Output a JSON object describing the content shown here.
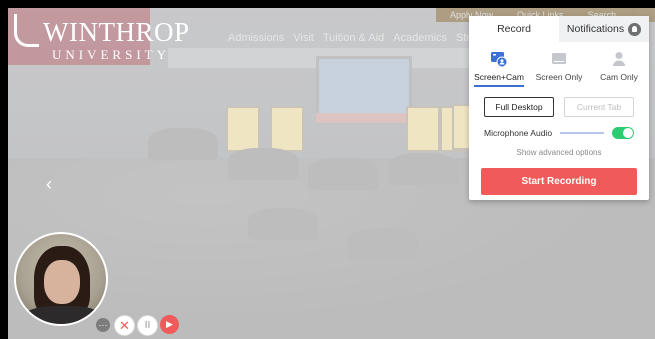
{
  "website": {
    "logo_main": "WINTHROP",
    "logo_sub": "UNIVERSITY",
    "nav": [
      "Admissions",
      "Visit",
      "Tuition & Aid",
      "Academics",
      "Studen"
    ],
    "top_links": [
      "Apply Now",
      "Quick Links",
      "Search"
    ]
  },
  "recorder": {
    "tabs": {
      "record": "Record",
      "notifications": "Notifications"
    },
    "modes": [
      {
        "label": "Screen+Cam",
        "icon": "screen-cam-icon",
        "active": true
      },
      {
        "label": "Screen Only",
        "icon": "screen-only-icon",
        "active": false
      },
      {
        "label": "Cam Only",
        "icon": "cam-only-icon",
        "active": false
      }
    ],
    "sources": {
      "full_desktop": "Full Desktop",
      "current_tab": "Current Tab"
    },
    "microphone_label": "Microphone Audio",
    "microphone_on": true,
    "advanced": "Show advanced options",
    "start": "Start Recording",
    "accent": "#f05a5a",
    "active_blue": "#3c6fd8"
  },
  "controls": {
    "more": "···",
    "cancel": "✕",
    "pause": "II",
    "play": "▶"
  }
}
